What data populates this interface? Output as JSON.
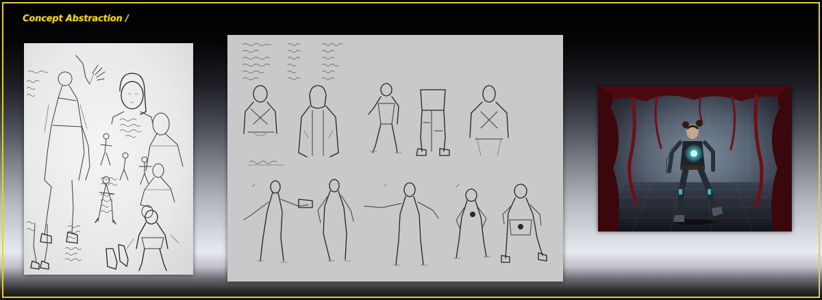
{
  "header": {
    "title": "Concept Abstraction /"
  },
  "colors": {
    "title": "#f2d617",
    "frame_border": "#e8d12a",
    "sketch_paper": "#ececec",
    "digital_canvas": "#c9c9c9",
    "cave_red": "#6e1016",
    "hologram_cyan": "#3fd7e6"
  },
  "panels": {
    "left": {
      "kind": "pencil-sketch-sheet"
    },
    "center": {
      "kind": "digital-concept-sheet",
      "figure_count_top": 5,
      "figure_count_bottom": 5
    },
    "right": {
      "kind": "character-render-in-cave"
    }
  }
}
